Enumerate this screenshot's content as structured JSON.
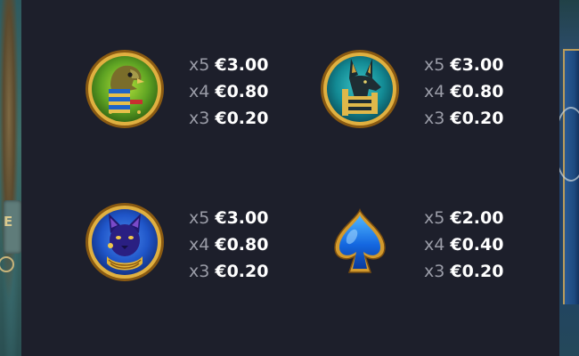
{
  "paytable": {
    "symbols": [
      {
        "icon": "horus-falcon-icon",
        "pays": [
          {
            "mult": "x5",
            "amount": "€3.00"
          },
          {
            "mult": "x4",
            "amount": "€0.80"
          },
          {
            "mult": "x3",
            "amount": "€0.20"
          }
        ]
      },
      {
        "icon": "anubis-jackal-icon",
        "pays": [
          {
            "mult": "x5",
            "amount": "€3.00"
          },
          {
            "mult": "x4",
            "amount": "€0.80"
          },
          {
            "mult": "x3",
            "amount": "€0.20"
          }
        ]
      },
      {
        "icon": "bastet-cat-icon",
        "pays": [
          {
            "mult": "x5",
            "amount": "€3.00"
          },
          {
            "mult": "x4",
            "amount": "€0.80"
          },
          {
            "mult": "x3",
            "amount": "€0.20"
          }
        ]
      },
      {
        "icon": "blue-spade-icon",
        "pays": [
          {
            "mult": "x5",
            "amount": "€2.00"
          },
          {
            "mult": "x4",
            "amount": "€0.40"
          },
          {
            "mult": "x3",
            "amount": "€0.20"
          }
        ]
      }
    ]
  },
  "colors": {
    "panel_bg": "#1d1f2b",
    "multiplier_text": "#9a9ca7",
    "amount_text": "#ffffff",
    "gold_frame": "#d8a83a"
  }
}
